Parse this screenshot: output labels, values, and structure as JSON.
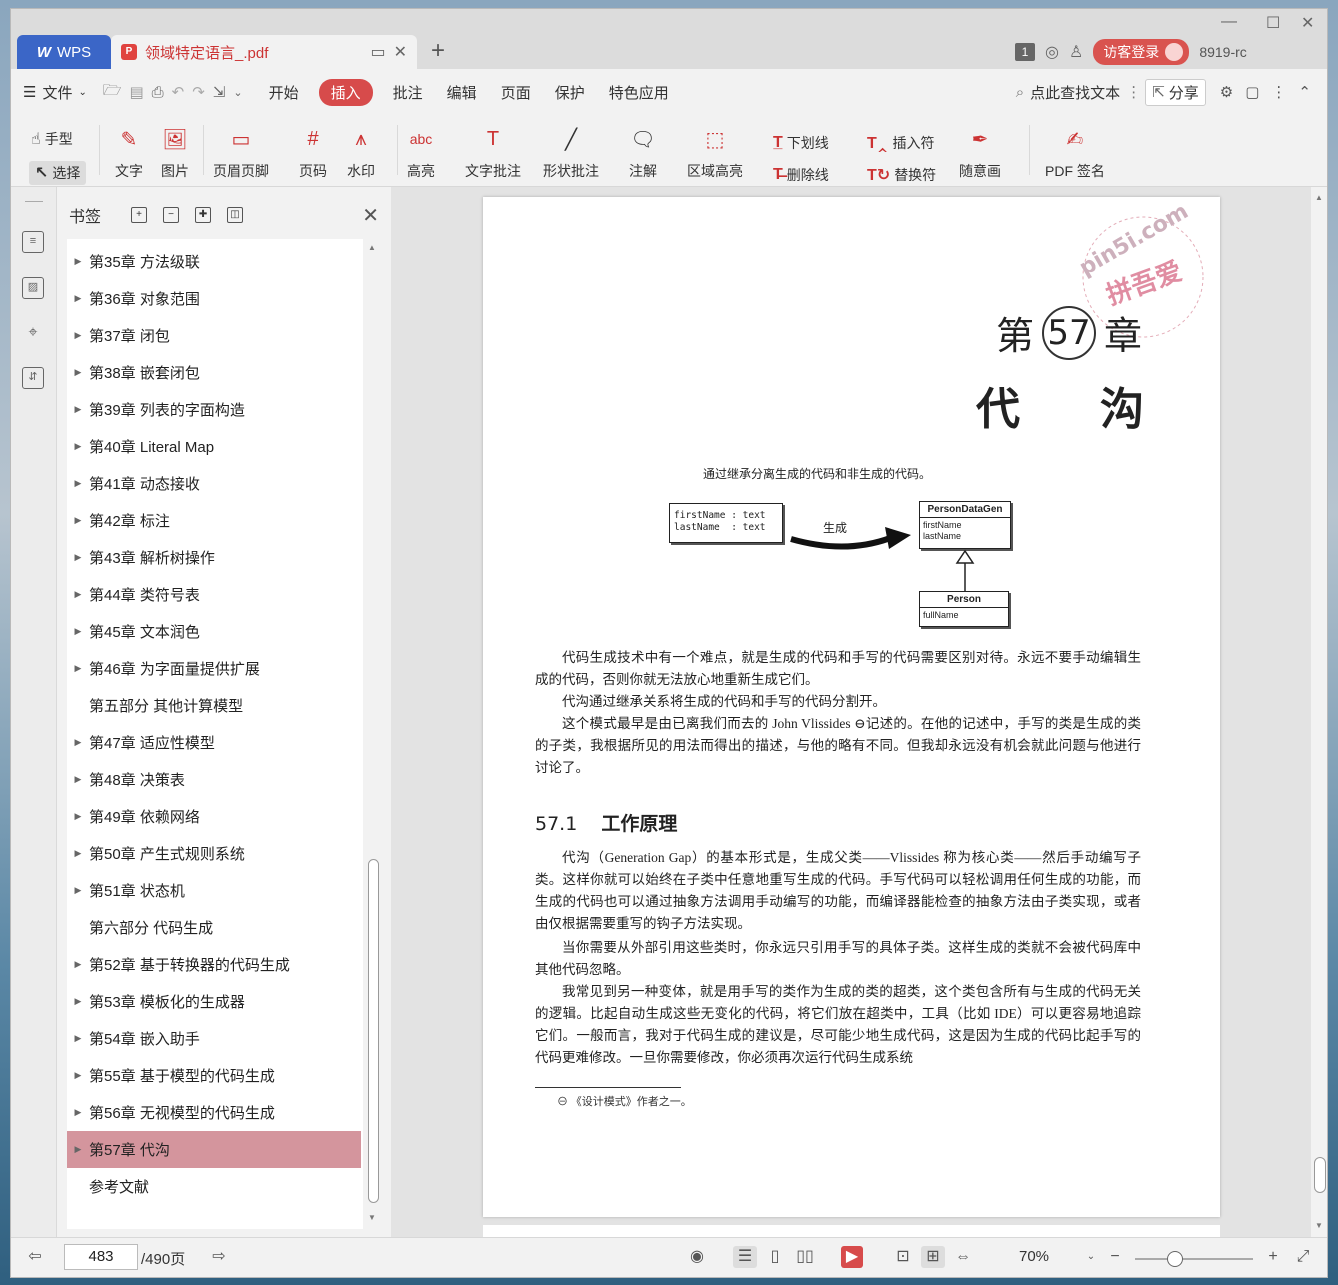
{
  "titlebar": {
    "app_tab": "WPS",
    "doc_tab": "领域特定语言_.pdf",
    "page_badge": "1",
    "login": "访客登录",
    "user_id": "8919-rc"
  },
  "menubar": {
    "file": "文件",
    "items": [
      "开始",
      "插入",
      "批注",
      "编辑",
      "页面",
      "保护",
      "特色应用"
    ],
    "active": "插入",
    "search": "点此查找文本",
    "share": "分享"
  },
  "ribbon": {
    "hand": "手型",
    "select": "选择",
    "text": "文字",
    "image": "图片",
    "header_footer": "页眉页脚",
    "page_num": "页码",
    "watermark": "水印",
    "highlight": "高亮",
    "text_note": "文字批注",
    "shape_note": "形状批注",
    "annotation": "注解",
    "area_highlight": "区域高亮",
    "underline": "下划线",
    "strikethrough": "删除线",
    "insert_mark": "插入符",
    "replace_mark": "替换符",
    "freehand": "随意画",
    "pdf_sign": "PDF 签名"
  },
  "bookmarks": {
    "title": "书签",
    "items": [
      {
        "label": "第35章 方法级联",
        "children": true
      },
      {
        "label": "第36章 对象范围",
        "children": true
      },
      {
        "label": "第37章 闭包",
        "children": true
      },
      {
        "label": "第38章 嵌套闭包",
        "children": true
      },
      {
        "label": "第39章 列表的字面构造",
        "children": true
      },
      {
        "label": "第40章 Literal Map",
        "children": true
      },
      {
        "label": "第41章 动态接收",
        "children": true
      },
      {
        "label": "第42章 标注",
        "children": true
      },
      {
        "label": "第43章 解析树操作",
        "children": true
      },
      {
        "label": "第44章 类符号表",
        "children": true
      },
      {
        "label": "第45章 文本润色",
        "children": true
      },
      {
        "label": "第46章 为字面量提供扩展",
        "children": true
      },
      {
        "label": "第五部分 其他计算模型",
        "children": false
      },
      {
        "label": "第47章 适应性模型",
        "children": true
      },
      {
        "label": "第48章 决策表",
        "children": true
      },
      {
        "label": "第49章 依赖网络",
        "children": true
      },
      {
        "label": "第50章 产生式规则系统",
        "children": true
      },
      {
        "label": "第51章 状态机",
        "children": true
      },
      {
        "label": "第六部分 代码生成",
        "children": false
      },
      {
        "label": "第52章 基于转换器的代码生成",
        "children": true
      },
      {
        "label": "第53章 模板化的生成器",
        "children": true
      },
      {
        "label": "第54章 嵌入助手",
        "children": true
      },
      {
        "label": "第55章 基于模型的代码生成",
        "children": true
      },
      {
        "label": "第56章 无视模型的代码生成",
        "children": true
      },
      {
        "label": "第57章 代沟",
        "children": true,
        "selected": true
      },
      {
        "label": "参考文献",
        "children": false
      }
    ]
  },
  "document": {
    "watermark": "pin5i.com 拼吾爱",
    "chapter_prefix": "第",
    "chapter_num": "57",
    "chapter_suffix": "章",
    "chapter_title": "代沟",
    "caption": "通过继承分离生成的代码和非生成的代码。",
    "diagram": {
      "left_box": [
        "firstName : text",
        "lastName  : text"
      ],
      "arrow_label": "生成",
      "class1": {
        "name": "PersonDataGen",
        "fields": [
          "firstName",
          "lastName"
        ]
      },
      "class2": {
        "name": "Person",
        "fields": [
          "fullName"
        ]
      }
    },
    "p1": "代码生成技术中有一个难点，就是生成的代码和手写的代码需要区别对待。永远不要手动编辑生成的代码，否则你就无法放心地重新生成它们。",
    "p2": "代沟通过继承关系将生成的代码和手写的代码分割开。",
    "p3": "这个模式最早是由已离我们而去的 John Vlissides ⊖记述的。在他的记述中，手写的类是生成的类的子类，我根据所见的用法而得出的描述，与他的略有不同。但我却永远没有机会就此问题与他进行讨论了。",
    "section_num": "57.1",
    "section_title": "工作原理",
    "p4": "代沟（Generation Gap）的基本形式是，生成父类——Vlissides 称为核心类——然后手动编写子类。这样你就可以始终在子类中任意地重写生成的代码。手写代码可以轻松调用任何生成的功能，而生成的代码也可以通过抽象方法调用手动编写的功能，而编译器能检查的抽象方法由子类实现，或者由仅根据需要重写的钩子方法实现。",
    "p5": "当你需要从外部引用这些类时，你永远只引用手写的具体子类。这样生成的类就不会被代码库中其他代码忽略。",
    "p6": "我常见到另一种变体，就是用手写的类作为生成的类的超类，这个类包含所有与生成的代码无关的逻辑。比起自动生成这些无变化的代码，将它们放在超类中，工具（比如 IDE）可以更容易地追踪它们。一般而言，我对于代码生成的建议是，尽可能少地生成代码，这是因为生成的代码比起手写的代码更难修改。一旦你需要修改，你必须再次运行代码生成系统",
    "footnote": "⊖ 《设计模式》作者之一。"
  },
  "statusbar": {
    "current_page": "483",
    "total_pages": "/490页",
    "zoom": "70%"
  },
  "colors": {
    "accent": "#d74b4b",
    "wps_blue": "#3b66c7",
    "selected_bookmark": "#d4959d"
  }
}
